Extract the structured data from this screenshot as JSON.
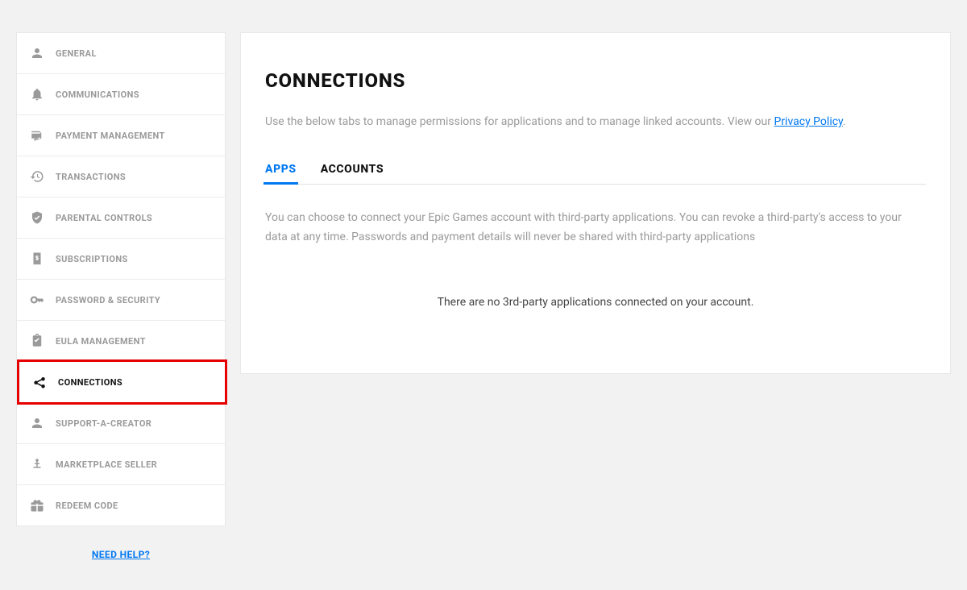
{
  "sidebar": {
    "items": [
      {
        "label": "GENERAL",
        "icon": "person-icon"
      },
      {
        "label": "COMMUNICATIONS",
        "icon": "bell-icon"
      },
      {
        "label": "PAYMENT MANAGEMENT",
        "icon": "payment-icon"
      },
      {
        "label": "TRANSACTIONS",
        "icon": "history-icon"
      },
      {
        "label": "PARENTAL CONTROLS",
        "icon": "shield-icon"
      },
      {
        "label": "SUBSCRIPTIONS",
        "icon": "receipt-icon"
      },
      {
        "label": "PASSWORD & SECURITY",
        "icon": "key-icon"
      },
      {
        "label": "EULA MANAGEMENT",
        "icon": "clipboard-icon"
      },
      {
        "label": "CONNECTIONS",
        "icon": "share-icon",
        "active": true
      },
      {
        "label": "SUPPORT-A-CREATOR",
        "icon": "person-icon"
      },
      {
        "label": "MARKETPLACE SELLER",
        "icon": "seller-icon"
      },
      {
        "label": "REDEEM CODE",
        "icon": "gift-icon"
      }
    ],
    "need_help": "NEED HELP?"
  },
  "main": {
    "title": "CONNECTIONS",
    "desc_prefix": "Use the below tabs to manage permissions for applications and to manage linked accounts. View our ",
    "privacy_link": "Privacy Policy",
    "desc_suffix": ".",
    "tabs": {
      "apps": "APPS",
      "accounts": "ACCOUNTS"
    },
    "apps_desc": "You can choose to connect your Epic Games account with third-party applications. You can revoke a third-party's access to your data at any time. Passwords and payment details will never be shared with third-party applications",
    "empty": "There are no 3rd-party applications connected on your account."
  }
}
